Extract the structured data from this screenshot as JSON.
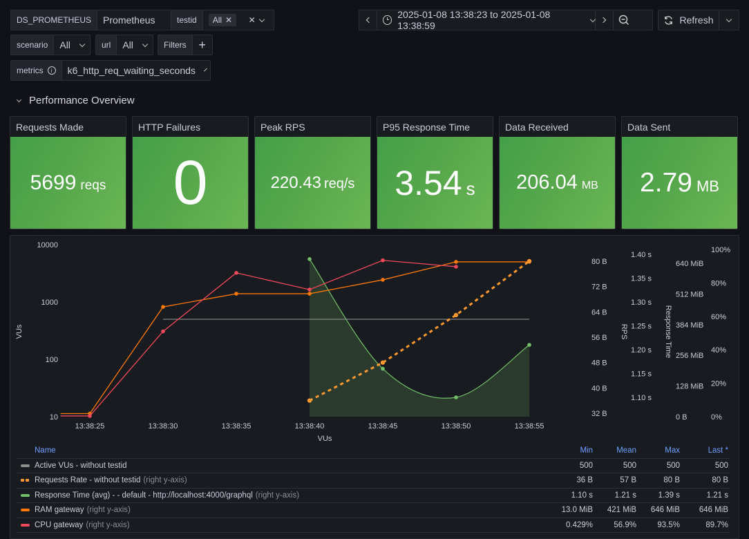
{
  "variables": {
    "datasource": {
      "label": "DS_PROMETHEUS",
      "value": "Prometheus"
    },
    "testid": {
      "label": "testid",
      "tag": "All"
    },
    "scenario": {
      "label": "scenario",
      "value": "All"
    },
    "url": {
      "label": "url",
      "value": "All"
    },
    "filters": {
      "label": "Filters",
      "add": "+"
    },
    "metrics": {
      "label": "metrics",
      "value": "k6_http_req_waiting_seconds"
    }
  },
  "toolbar": {
    "time_range": "2025-01-08 13:38:23 to 2025-01-08 13:38:59",
    "refresh_label": "Refresh"
  },
  "row": {
    "title": "Performance Overview"
  },
  "stats": [
    {
      "title": "Requests Made",
      "value": "5699",
      "unit": "reqs",
      "color": "#56a64b"
    },
    {
      "title": "HTTP Failures",
      "value": "0",
      "unit": "",
      "color": "#56a64b"
    },
    {
      "title": "Peak RPS",
      "value": "220.43",
      "unit": "req/s",
      "color": "#56a64b"
    },
    {
      "title": "P95 Response Time",
      "value": "3.54",
      "unit": "s",
      "color": "#56a64b"
    },
    {
      "title": "Data Received",
      "value": "206.04",
      "unit": "MB",
      "color": "#56a64b"
    },
    {
      "title": "Data Sent",
      "value": "2.79",
      "unit": "MB",
      "color": "#56a64b"
    }
  ],
  "chart_data": {
    "type": "line",
    "title": "",
    "xlabel": "VUs",
    "x_ticks": [
      "13:38:25",
      "13:38:30",
      "13:38:35",
      "13:38:40",
      "13:38:45",
      "13:38:50",
      "13:38:55"
    ],
    "x_range_seconds": [
      23,
      59
    ],
    "axes": {
      "left": {
        "label": "VUs",
        "scale": "log",
        "ticks": [
          "10",
          "100",
          "1000",
          "10000"
        ],
        "range": [
          10,
          10000
        ]
      },
      "right1": {
        "label": "RPS",
        "ticks": [
          "32 B",
          "40 B",
          "48 B",
          "56 B",
          "64 B",
          "72 B",
          "80 B"
        ],
        "range": [
          32,
          80
        ]
      },
      "right2": {
        "label": "Response Time",
        "ticks": [
          "1.10 s",
          "1.15 s",
          "1.20 s",
          "1.25 s",
          "1.30 s",
          "1.35 s",
          "1.40 s"
        ],
        "range": [
          1.1,
          1.4
        ]
      },
      "right3": {
        "label": "",
        "ticks": [
          "0 B",
          "128 MiB",
          "256 MiB",
          "384 MiB",
          "512 MiB",
          "640 MiB"
        ],
        "range": [
          0,
          640
        ]
      },
      "right4": {
        "label": "",
        "ticks": [
          "0%",
          "20%",
          "40%",
          "60%",
          "80%",
          "100%"
        ],
        "range": [
          0,
          100
        ]
      }
    },
    "series": [
      {
        "name": "Active VUs - without testid",
        "axis": "left",
        "color": "#8e8e8e",
        "style": "solid",
        "points": [
          [
            30,
            500
          ],
          [
            55,
            500
          ]
        ],
        "markers": false
      },
      {
        "name": "Requests Rate - without testid",
        "suffix": "(right y-axis)",
        "axis": "right1",
        "color": "#ff9830",
        "style": "dash",
        "points": [
          [
            40,
            36
          ],
          [
            45,
            48
          ],
          [
            50,
            63
          ],
          [
            55,
            80
          ]
        ],
        "markers": true
      },
      {
        "name": "Response Time (avg) - - default - http://localhost:4000/graphql",
        "suffix": "(right y-axis)",
        "axis": "right2",
        "color": "#73bf69",
        "style": "smooth-fill",
        "points": [
          [
            40,
            1.39
          ],
          [
            45,
            1.16
          ],
          [
            50,
            1.1
          ],
          [
            55,
            1.21
          ]
        ],
        "markers": true
      },
      {
        "name": "RAM gateway",
        "suffix": "(right y-axis)",
        "axis": "right3",
        "color": "#ff780a",
        "style": "solid",
        "points": [
          [
            23,
            13
          ],
          [
            25,
            13
          ],
          [
            30,
            458
          ],
          [
            35,
            513
          ],
          [
            40,
            513
          ],
          [
            45,
            571
          ],
          [
            50,
            646
          ],
          [
            55,
            646
          ]
        ],
        "markers": true
      },
      {
        "name": "CPU gateway",
        "suffix": "(right y-axis)",
        "axis": "right4",
        "color": "#f2495c",
        "style": "solid",
        "points": [
          [
            23,
            0.429
          ],
          [
            25,
            0.429
          ],
          [
            30,
            51
          ],
          [
            35,
            86
          ],
          [
            40,
            76
          ],
          [
            45,
            93.5
          ],
          [
            50,
            89.7
          ]
        ],
        "markers": true
      }
    ]
  },
  "legend": {
    "headers": {
      "name": "Name",
      "min": "Min",
      "mean": "Mean",
      "max": "Max",
      "last": "Last *"
    },
    "rows": [
      {
        "name": "Active VUs - without testid",
        "suffix": "",
        "color": "#8e8e8e",
        "dash": false,
        "min": "500",
        "mean": "500",
        "max": "500",
        "last": "500"
      },
      {
        "name": "Requests Rate - without testid",
        "suffix": "(right y-axis)",
        "color": "#ff9830",
        "dash": true,
        "min": "36 B",
        "mean": "57 B",
        "max": "80 B",
        "last": "80 B"
      },
      {
        "name": "Response Time (avg) - - default - http://localhost:4000/graphql",
        "suffix": "(right y-axis)",
        "color": "#73bf69",
        "dash": false,
        "min": "1.10 s",
        "mean": "1.21 s",
        "max": "1.39 s",
        "last": "1.21 s"
      },
      {
        "name": "RAM gateway",
        "suffix": "(right y-axis)",
        "color": "#ff780a",
        "dash": false,
        "min": "13.0 MiB",
        "mean": "421 MiB",
        "max": "646 MiB",
        "last": "646 MiB"
      },
      {
        "name": "CPU gateway",
        "suffix": "(right y-axis)",
        "color": "#f2495c",
        "dash": false,
        "min": "0.429%",
        "mean": "56.9%",
        "max": "93.5%",
        "last": "89.7%"
      }
    ]
  }
}
